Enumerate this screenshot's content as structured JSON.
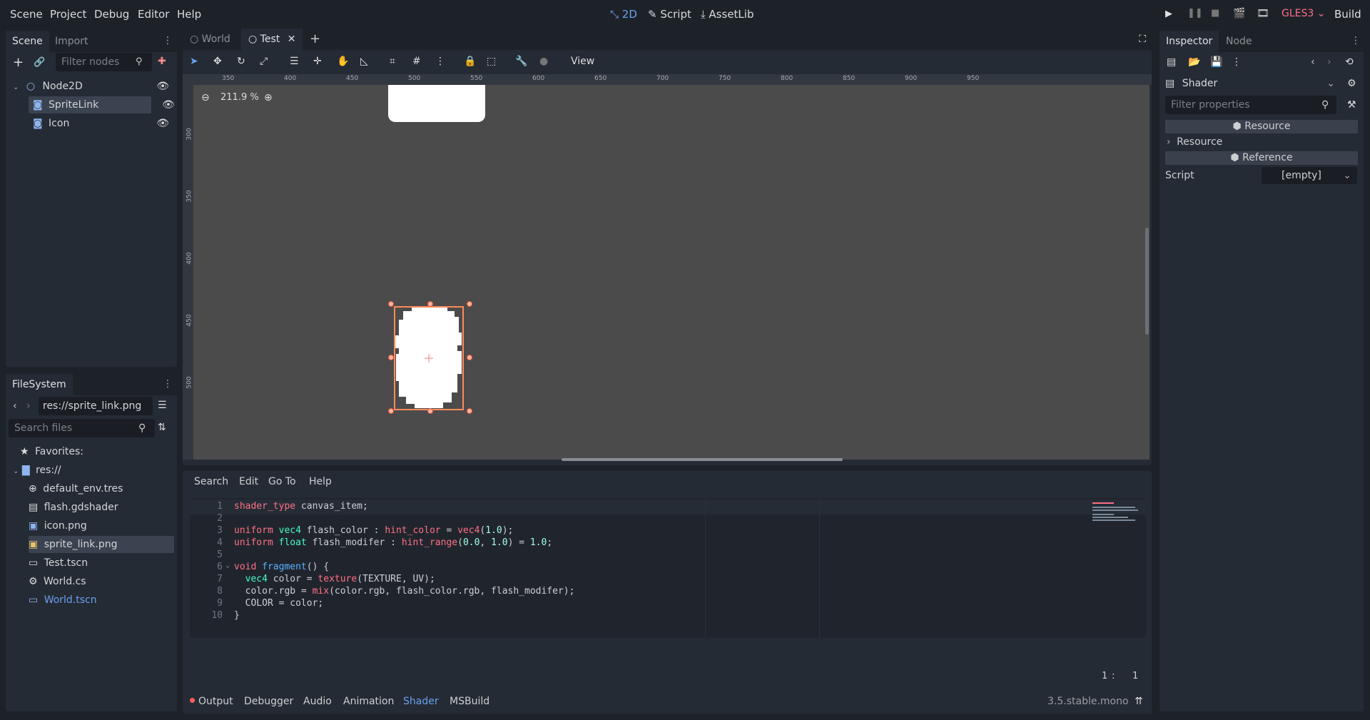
{
  "menu": [
    "Scene",
    "Project",
    "Debug",
    "Editor",
    "Help"
  ],
  "workspaces": {
    "w2d": "2D",
    "script": "Script",
    "assetlib": "AssetLib"
  },
  "run": {
    "renderer": "GLES3",
    "build": "Build"
  },
  "scene_dock": {
    "tabs": [
      "Scene",
      "Import"
    ],
    "filter_placeholder": "Filter nodes",
    "nodes": [
      {
        "name": "Node2D",
        "icon": "node2d-icon"
      },
      {
        "name": "SpriteLink",
        "icon": "sprite-icon",
        "selected": true
      },
      {
        "name": "Icon",
        "icon": "sprite-icon"
      }
    ]
  },
  "filesystem": {
    "title": "FileSystem",
    "path": "res://sprite_link.png",
    "search_placeholder": "Search files",
    "favorites": "Favorites:",
    "root": "res://",
    "files": [
      {
        "name": "default_env.tres",
        "icon": "globe-icon"
      },
      {
        "name": "flash.gdshader",
        "icon": "shader-icon"
      },
      {
        "name": "icon.png",
        "icon": "image-icon"
      },
      {
        "name": "sprite_link.png",
        "icon": "image-icon",
        "selected": true
      },
      {
        "name": "Test.tscn",
        "icon": "scene-icon"
      },
      {
        "name": "World.cs",
        "icon": "script-icon"
      },
      {
        "name": "World.tscn",
        "icon": "scene-icon",
        "highlight": true
      }
    ]
  },
  "scene_tabs": [
    "World",
    "Test"
  ],
  "toolbar": {
    "view": "View"
  },
  "zoom": "211.9 %",
  "ruler_h": [
    "350",
    "400",
    "450",
    "500",
    "550",
    "600",
    "650",
    "700",
    "750",
    "800",
    "850",
    "900",
    "950"
  ],
  "ruler_v": [
    "300",
    "350",
    "400",
    "450",
    "500"
  ],
  "shader_editor": {
    "menu": [
      "Search",
      "Edit",
      "Go To",
      "Help"
    ],
    "lines": [
      {
        "n": "1",
        "t": "shader_type canvas_item;"
      },
      {
        "n": "2",
        "t": ""
      },
      {
        "n": "3",
        "t": "uniform vec4 flash_color : hint_color = vec4(1.0);"
      },
      {
        "n": "4",
        "t": "uniform float flash_modifer : hint_range(0.0, 1.0) = 1.0;"
      },
      {
        "n": "5",
        "t": ""
      },
      {
        "n": "6",
        "t": "void fragment() {"
      },
      {
        "n": "7",
        "t": "  vec4 color = texture(TEXTURE, UV);"
      },
      {
        "n": "8",
        "t": "  color.rgb = mix(color.rgb, flash_color.rgb, flash_modifer);"
      },
      {
        "n": "9",
        "t": "  COLOR = color;"
      },
      {
        "n": "10",
        "t": "}"
      }
    ],
    "cursor_line": "1",
    "cursor_col": "1"
  },
  "bottom_tabs": [
    "Output",
    "Debugger",
    "Audio",
    "Animation",
    "Shader",
    "MSBuild"
  ],
  "version": "3.5.stable.mono",
  "inspector": {
    "tabs": [
      "Inspector",
      "Node"
    ],
    "resource_type": "Shader",
    "filter_placeholder": "Filter properties",
    "section_resource": "Resource",
    "row_resource": "Resource",
    "section_reference": "Reference",
    "script_label": "Script",
    "script_value": "[empty]"
  },
  "colors": {
    "accent": "#699ce8",
    "selection": "#ff8a5b",
    "shader_kw": "#ff7085",
    "warning": "#ff5d5d"
  }
}
